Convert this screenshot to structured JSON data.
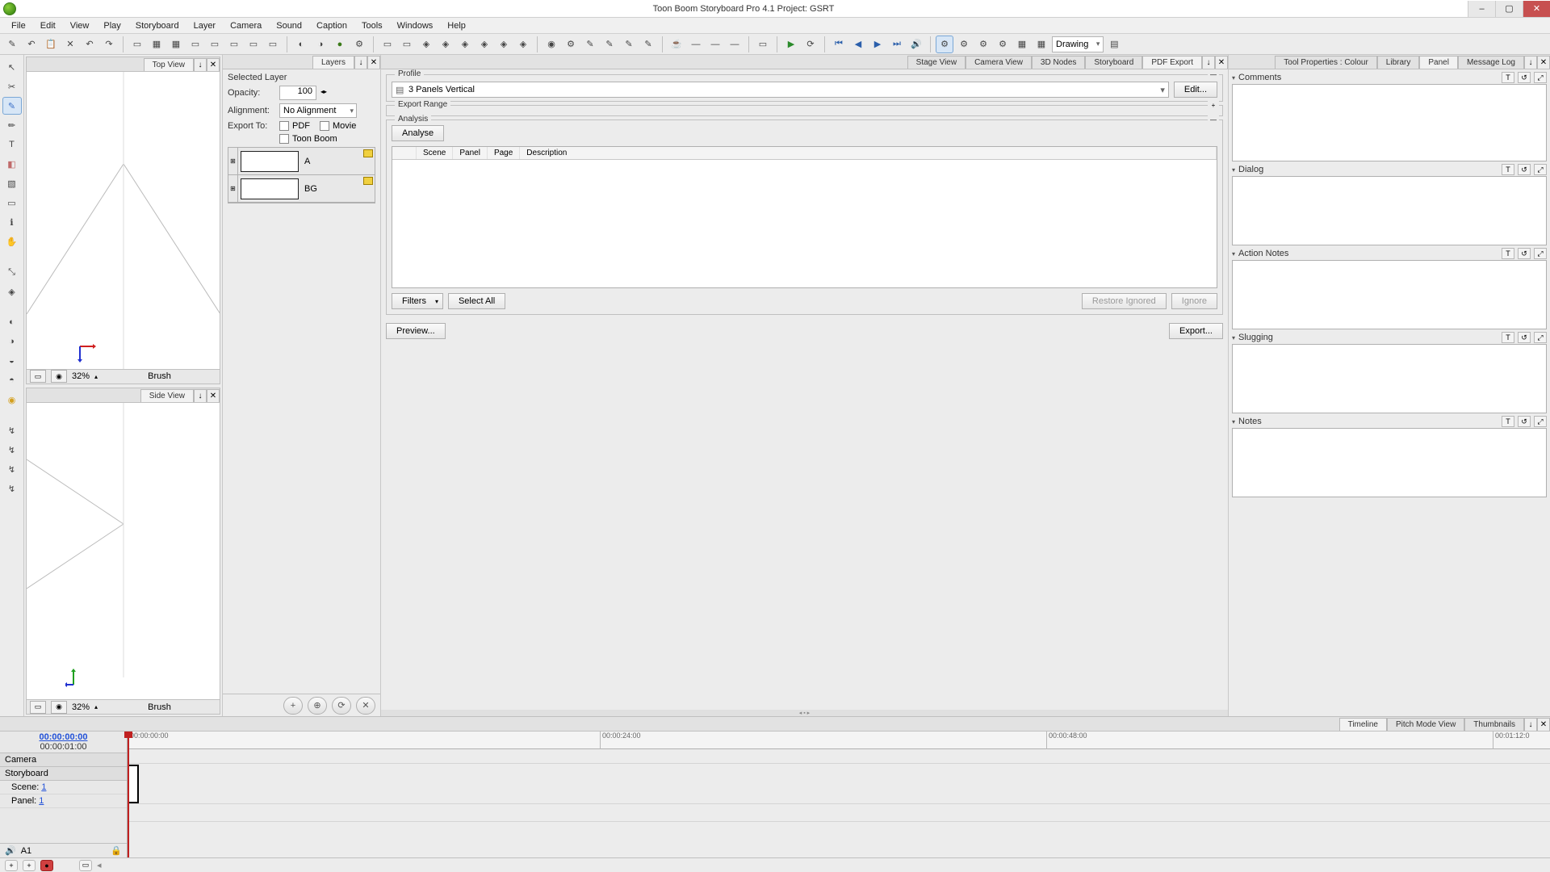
{
  "window": {
    "title": "Toon Boom Storyboard Pro 4.1 Project: GSRT"
  },
  "menu": [
    "File",
    "Edit",
    "View",
    "Play",
    "Storyboard",
    "Layer",
    "Camera",
    "Sound",
    "Caption",
    "Tools",
    "Windows",
    "Help"
  ],
  "toolbar": {
    "mode_select": "Drawing"
  },
  "views": {
    "top": {
      "tab": "Top View",
      "zoom": "32%",
      "tool": "Brush"
    },
    "side": {
      "tab": "Side View",
      "zoom": "32%",
      "tool": "Brush"
    }
  },
  "layers": {
    "tab": "Layers",
    "heading": "Selected Layer",
    "opacity_label": "Opacity:",
    "opacity_value": "100",
    "alignment_label": "Alignment:",
    "alignment_value": "No Alignment",
    "exportto_label": "Export To:",
    "chk_pdf": "PDF",
    "chk_movie": "Movie",
    "chk_toonboom": "Toon Boom",
    "items": [
      {
        "name": "A"
      },
      {
        "name": "BG"
      }
    ]
  },
  "center": {
    "tabs": [
      "Stage View",
      "Camera View",
      "3D Nodes",
      "Storyboard",
      "PDF Export"
    ],
    "active_tab": "PDF Export",
    "profile_legend": "Profile",
    "profile_value": "3 Panels Vertical",
    "edit_btn": "Edit...",
    "range_legend": "Export Range",
    "analysis_legend": "Analysis",
    "analyse_btn": "Analyse",
    "grid_cols": [
      "Scene",
      "Panel",
      "Page",
      "Description"
    ],
    "filters_btn": "Filters",
    "selectall_btn": "Select All",
    "restore_btn": "Restore Ignored",
    "ignore_btn": "Ignore",
    "preview_btn": "Preview...",
    "export_btn": "Export..."
  },
  "right": {
    "tabs": [
      "Tool Properties : Colour",
      "Library",
      "Panel",
      "Message Log"
    ],
    "active_tab": "Panel",
    "sections": [
      "Comments",
      "Dialog",
      "Action Notes",
      "Slugging",
      "Notes"
    ]
  },
  "timeline": {
    "tabs": [
      "Timeline",
      "Pitch Mode View",
      "Thumbnails"
    ],
    "active_tab": "Timeline",
    "timecode": "00:00:00:00",
    "duration": "00:00:01:00",
    "camera": "Camera",
    "storyboard": "Storyboard",
    "scene_label": "Scene:",
    "scene_value": "1",
    "panel_label": "Panel:",
    "panel_value": "1",
    "audio": "A1",
    "ticks": [
      {
        "pos": 0,
        "label": "00:00:00:00"
      },
      {
        "pos": 585,
        "label": "00:00:24:00"
      },
      {
        "pos": 1138,
        "label": "00:00:48:00"
      },
      {
        "pos": 1691,
        "label": "00:01:12:0"
      }
    ]
  }
}
